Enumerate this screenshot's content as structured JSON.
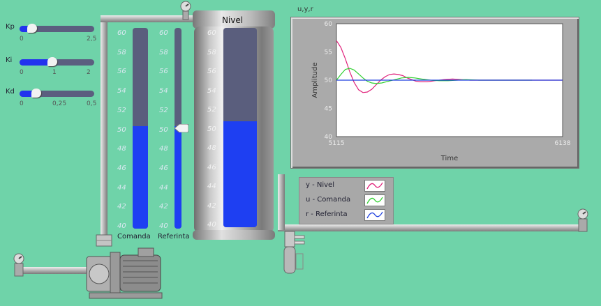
{
  "sliders": [
    {
      "label": "Kp",
      "ticks": [
        "0",
        "2,5"
      ],
      "fraction": 0.12
    },
    {
      "label": "Ki",
      "ticks": [
        "0",
        "1",
        "2"
      ],
      "fraction": 0.42
    },
    {
      "label": "Kd",
      "ticks": [
        "0",
        "0,25",
        "0,5"
      ],
      "fraction": 0.18
    }
  ],
  "comanda": {
    "label": "Comanda",
    "fraction": 0.51
  },
  "referinta": {
    "label": "Referinta",
    "fraction": 0.51
  },
  "scale_ticks": [
    "60",
    "58",
    "56",
    "54",
    "52",
    "50",
    "48",
    "46",
    "44",
    "42",
    "40"
  ],
  "tank": {
    "title": "Nivel",
    "fraction": 0.53
  },
  "chart": {
    "header": "u,y,r",
    "ylabel": "Amplitude",
    "xlabel": "Time",
    "x_ticks": [
      "5115",
      "6138"
    ],
    "y_ticks": [
      "60",
      "55",
      "50",
      "45",
      "40"
    ]
  },
  "chart_data": {
    "type": "line",
    "ylim": [
      40,
      60
    ],
    "xlim": [
      5115,
      6138
    ],
    "series": [
      {
        "name": "y - Nivel",
        "color": "#e0207a",
        "x": [
          5115,
          5135,
          5155,
          5175,
          5195,
          5215,
          5235,
          5255,
          5275,
          5295,
          5315,
          5335,
          5355,
          5375,
          5395,
          5415,
          5435,
          5455,
          5475,
          5495,
          5525,
          5560,
          5600,
          5640,
          5680,
          5720,
          5760,
          5800,
          5900,
          6000,
          6138
        ],
        "values": [
          57.0,
          55.8,
          53.8,
          51.5,
          49.6,
          48.3,
          47.8,
          47.9,
          48.4,
          49.2,
          50.0,
          50.6,
          51.0,
          51.1,
          51.0,
          50.8,
          50.4,
          50.1,
          49.8,
          49.7,
          49.7,
          49.9,
          50.1,
          50.2,
          50.1,
          50.0,
          50.0,
          50.0,
          50.0,
          50.0,
          50.0
        ]
      },
      {
        "name": "u - Comanda",
        "color": "#30d030",
        "x": [
          5115,
          5135,
          5155,
          5175,
          5195,
          5215,
          5235,
          5255,
          5275,
          5295,
          5320,
          5350,
          5380,
          5410,
          5440,
          5470,
          5500,
          5540,
          5580,
          5620,
          5660,
          5700,
          5760,
          5900,
          6000
        ],
        "values": [
          50.0,
          51.0,
          51.9,
          52.1,
          51.8,
          51.1,
          50.4,
          49.8,
          49.5,
          49.4,
          49.5,
          49.8,
          50.1,
          50.4,
          50.5,
          50.4,
          50.2,
          50.0,
          49.9,
          49.9,
          50.0,
          50.1,
          50.0,
          50.0,
          50.0
        ]
      },
      {
        "name": "r - Referinta",
        "color": "#2040e0",
        "x": [
          5115,
          6138
        ],
        "values": [
          50.0,
          50.0
        ]
      }
    ]
  }
}
